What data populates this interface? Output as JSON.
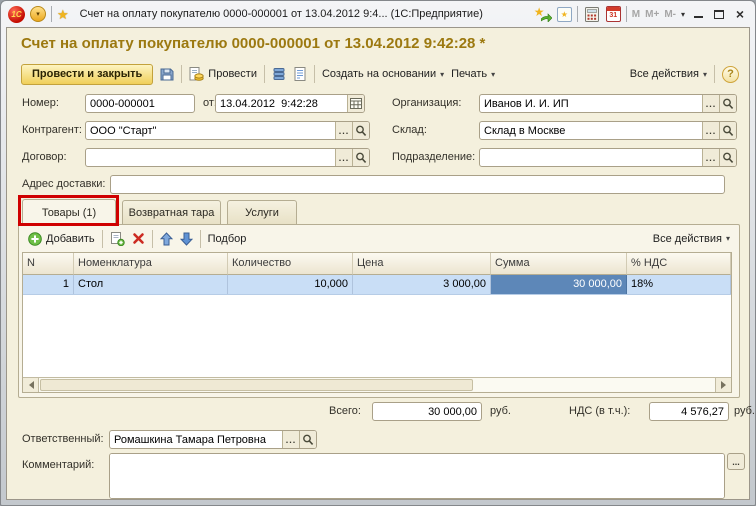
{
  "titlebar": {
    "title": "Счет на оплату покупателю 0000-000001 от 13.04.2012 9:4...  (1С:Предприятие)",
    "logo_text": "1С",
    "calendar_day": "31",
    "memory": [
      "M",
      "M+",
      "M-"
    ]
  },
  "header": {
    "title": "Счет на оплату покупателю 0000-000001 от 13.04.2012 9:42:28 *"
  },
  "toolbar": {
    "post_close": "Провести и закрыть",
    "post": "Провести",
    "create_on_basis": "Создать на основании",
    "print": "Печать",
    "all_actions": "Все действия",
    "help": "?"
  },
  "fields": {
    "number_label": "Номер:",
    "number_value": "0000-000001",
    "date_label": "от:",
    "date_value": "13.04.2012  9:42:28",
    "organization_label": "Организация:",
    "organization_value": "Иванов И. И. ИП",
    "counterparty_label": "Контрагент:",
    "counterparty_value": "ООО \"Старт\"",
    "warehouse_label": "Склад:",
    "warehouse_value": "Склад в Москве",
    "contract_label": "Договор:",
    "contract_value": "",
    "department_label": "Подразделение:",
    "department_value": "",
    "delivery_address_label": "Адрес доставки:",
    "delivery_address_value": ""
  },
  "tabs": {
    "goods": "Товары (1)",
    "tare": "Возвратная тара",
    "services": "Услуги"
  },
  "items_toolbar": {
    "add": "Добавить",
    "pick": "Подбор",
    "all_actions": "Все действия"
  },
  "table": {
    "columns": [
      "N",
      "Номенклатура",
      "Количество",
      "Цена",
      "Сумма",
      "% НДС"
    ],
    "rows": [
      {
        "n": "1",
        "name": "Стол",
        "qty": "10,000",
        "price": "3 000,00",
        "sum": "30 000,00",
        "vat": "18%"
      }
    ]
  },
  "totals": {
    "total_label": "Всего:",
    "total_value": "30 000,00",
    "total_currency": "руб.",
    "vat_label": "НДС (в т.ч.):",
    "vat_value": "4 576,27",
    "vat_currency": "руб."
  },
  "footer": {
    "responsible_label": "Ответственный:",
    "responsible_value": "Ромашкина Тамара Петровна",
    "comment_label": "Комментарий:",
    "comment_value": ""
  },
  "icons": {
    "star": "★",
    "dropdown": "▾",
    "ellipsis": "...",
    "close": "×"
  }
}
